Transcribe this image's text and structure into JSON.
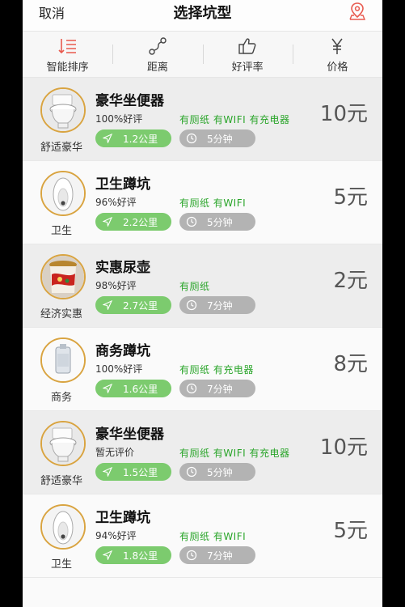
{
  "nav": {
    "cancel": "取消",
    "title": "选择坑型"
  },
  "filters": [
    {
      "label": "智能排序",
      "icon": "sort-icon",
      "color": "#e85a4f"
    },
    {
      "label": "距离",
      "icon": "route-icon"
    },
    {
      "label": "好评率",
      "icon": "thumbs-up-icon"
    },
    {
      "label": "价格",
      "icon": "yen-icon"
    }
  ],
  "colors": {
    "green": "#2aa52a",
    "pill_green": "#7ccb6e",
    "pill_gray": "#b3b3b3",
    "avatar_border": "#d9a441",
    "price": "#555555"
  },
  "items": [
    {
      "category": "舒适豪华",
      "name": "豪华坐便器",
      "rating": "100%好评",
      "amenities": "有厕纸 有WIFI 有充电器",
      "distance": "1.2公里",
      "time": "5分钟",
      "price": "10元",
      "image": "toilet"
    },
    {
      "category": "卫生",
      "name": "卫生蹲坑",
      "rating": "96%好评",
      "amenities": "有厕纸 有WIFI",
      "distance": "2.2公里",
      "time": "5分钟",
      "price": "5元",
      "image": "squat"
    },
    {
      "category": "经济实惠",
      "name": "实惠尿壶",
      "rating": "98%好评",
      "amenities": "有厕纸",
      "distance": "2.7公里",
      "time": "7分钟",
      "price": "2元",
      "image": "pot"
    },
    {
      "category": "商务",
      "name": "商务蹲坑",
      "rating": "100%好评",
      "amenities": "有厕纸 有充电器",
      "distance": "1.6公里",
      "time": "7分钟",
      "price": "8元",
      "image": "roll"
    },
    {
      "category": "舒适豪华",
      "name": "豪华坐便器",
      "rating": "暂无评价",
      "amenities": "有厕纸 有WIFI 有充电器",
      "distance": "1.5公里",
      "time": "5分钟",
      "price": "10元",
      "image": "toilet"
    },
    {
      "category": "卫生",
      "name": "卫生蹲坑",
      "rating": "94%好评",
      "amenities": "有厕纸 有WIFI",
      "distance": "1.8公里",
      "time": "7分钟",
      "price": "5元",
      "image": "squat"
    }
  ]
}
